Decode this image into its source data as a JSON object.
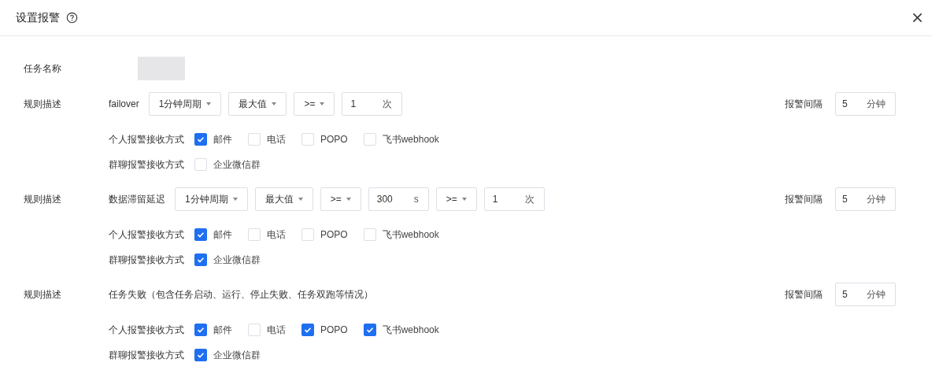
{
  "dialog": {
    "title": "设置报警",
    "task_name": {
      "label": "任务名称"
    },
    "rules": [
      {
        "label": "规则描述",
        "parts": [
          {
            "kind": "text",
            "text": "failover"
          },
          {
            "kind": "select",
            "value": "1分钟周期"
          },
          {
            "kind": "select",
            "value": "最大值"
          },
          {
            "kind": "select",
            "value": ">="
          },
          {
            "kind": "input",
            "value": "1",
            "unit": "次"
          }
        ],
        "interval": {
          "label": "报警间隔",
          "value": "5",
          "unit": "分钟"
        },
        "personal": {
          "label": "个人报警接收方式",
          "options": [
            {
              "label": "邮件",
              "checked": true
            },
            {
              "label": "电话",
              "checked": false
            },
            {
              "label": "POPO",
              "checked": false
            },
            {
              "label": "飞书webhook",
              "checked": false
            }
          ]
        },
        "group": {
          "label": "群聊报警接收方式",
          "options": [
            {
              "label": "企业微信群",
              "checked": false
            }
          ]
        }
      },
      {
        "label": "规则描述",
        "parts": [
          {
            "kind": "text",
            "text": "数据滞留延迟"
          },
          {
            "kind": "select",
            "value": "1分钟周期"
          },
          {
            "kind": "select",
            "value": "最大值"
          },
          {
            "kind": "select",
            "value": ">="
          },
          {
            "kind": "input",
            "value": "300",
            "unit": "s"
          },
          {
            "kind": "select",
            "value": ">="
          },
          {
            "kind": "input",
            "value": "1",
            "unit": "次"
          }
        ],
        "interval": {
          "label": "报警间隔",
          "value": "5",
          "unit": "分钟"
        },
        "personal": {
          "label": "个人报警接收方式",
          "options": [
            {
              "label": "邮件",
              "checked": true
            },
            {
              "label": "电话",
              "checked": false
            },
            {
              "label": "POPO",
              "checked": false
            },
            {
              "label": "飞书webhook",
              "checked": false
            }
          ]
        },
        "group": {
          "label": "群聊报警接收方式",
          "options": [
            {
              "label": "企业微信群",
              "checked": true
            }
          ]
        }
      },
      {
        "label": "规则描述",
        "parts": [
          {
            "kind": "text",
            "text": "任务失败（包含任务启动、运行、停止失败、任务双跑等情况）"
          }
        ],
        "interval": {
          "label": "报警间隔",
          "value": "5",
          "unit": "分钟"
        },
        "personal": {
          "label": "个人报警接收方式",
          "options": [
            {
              "label": "邮件",
              "checked": true
            },
            {
              "label": "电话",
              "checked": false
            },
            {
              "label": "POPO",
              "checked": true
            },
            {
              "label": "飞书webhook",
              "checked": true
            }
          ]
        },
        "group": {
          "label": "群聊报警接收方式",
          "options": [
            {
              "label": "企业微信群",
              "checked": true
            }
          ]
        }
      }
    ]
  }
}
